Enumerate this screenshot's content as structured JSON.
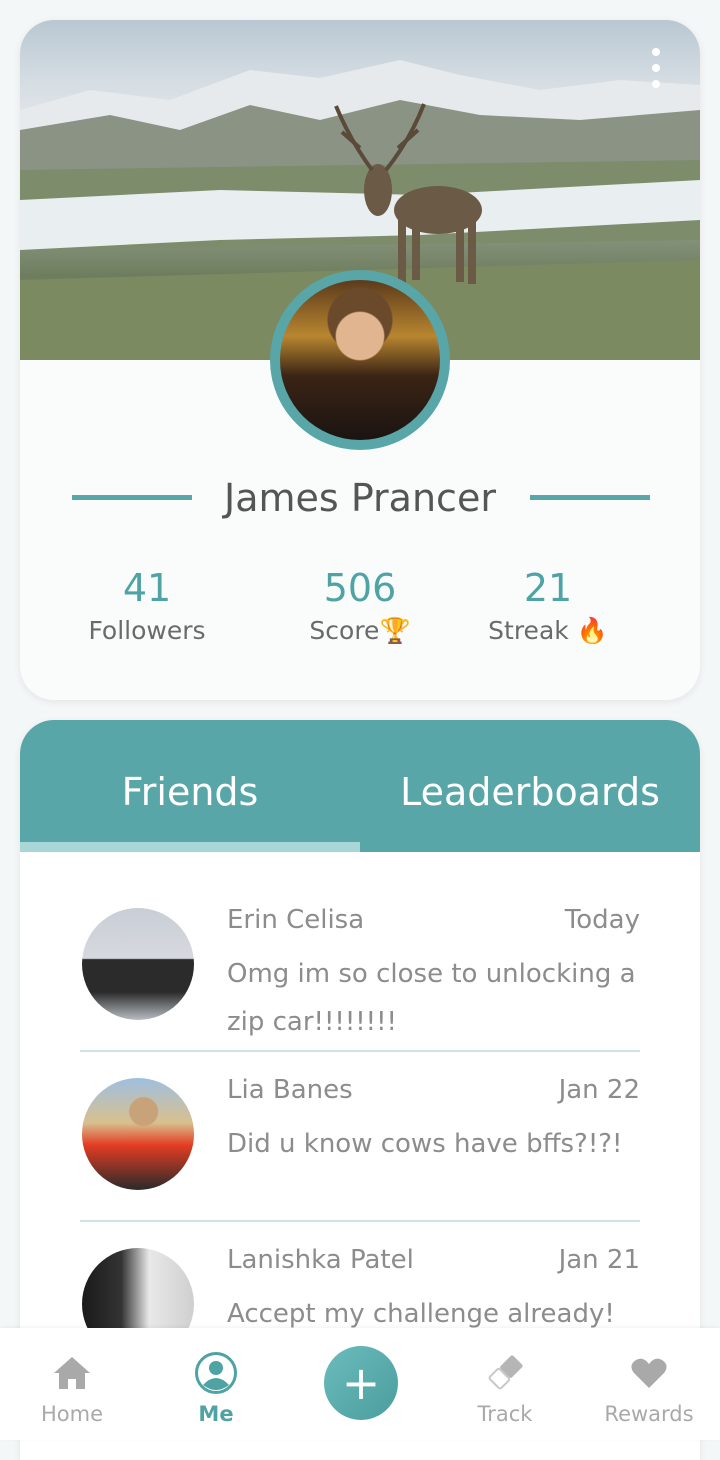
{
  "profile": {
    "name": "James Prancer",
    "stats": [
      {
        "value": "41",
        "label": "Followers",
        "emoji": ""
      },
      {
        "value": "506",
        "label": "Score",
        "emoji": "🏆"
      },
      {
        "value": "21",
        "label": "Streak",
        "emoji": "🔥"
      }
    ]
  },
  "tabs": {
    "friends": "Friends",
    "leaderboards": "Leaderboards",
    "active": "Friends"
  },
  "friends": [
    {
      "name": "Erin Celisa",
      "date": "Today",
      "message": "Omg im so close to unlocking a zip car!!!!!!!!"
    },
    {
      "name": "Lia Banes",
      "date": "Jan  22",
      "message": "Did u know cows have bffs?!?!"
    },
    {
      "name": "Lanishka Patel",
      "date": "Jan 21",
      "message": "Accept my challenge already!"
    }
  ],
  "nav": {
    "home": "Home",
    "me": "Me",
    "add": "+",
    "track": "Track",
    "rewards": "Rewards",
    "active": "Me"
  },
  "colors": {
    "accent": "#58a6a7",
    "tab_indicator": "#a9d6d6",
    "text_muted": "#8c8c8c"
  },
  "icons": [
    "more-vert-icon",
    "home-icon",
    "person-icon",
    "plus-icon",
    "eraser-icon",
    "heart-icon"
  ]
}
